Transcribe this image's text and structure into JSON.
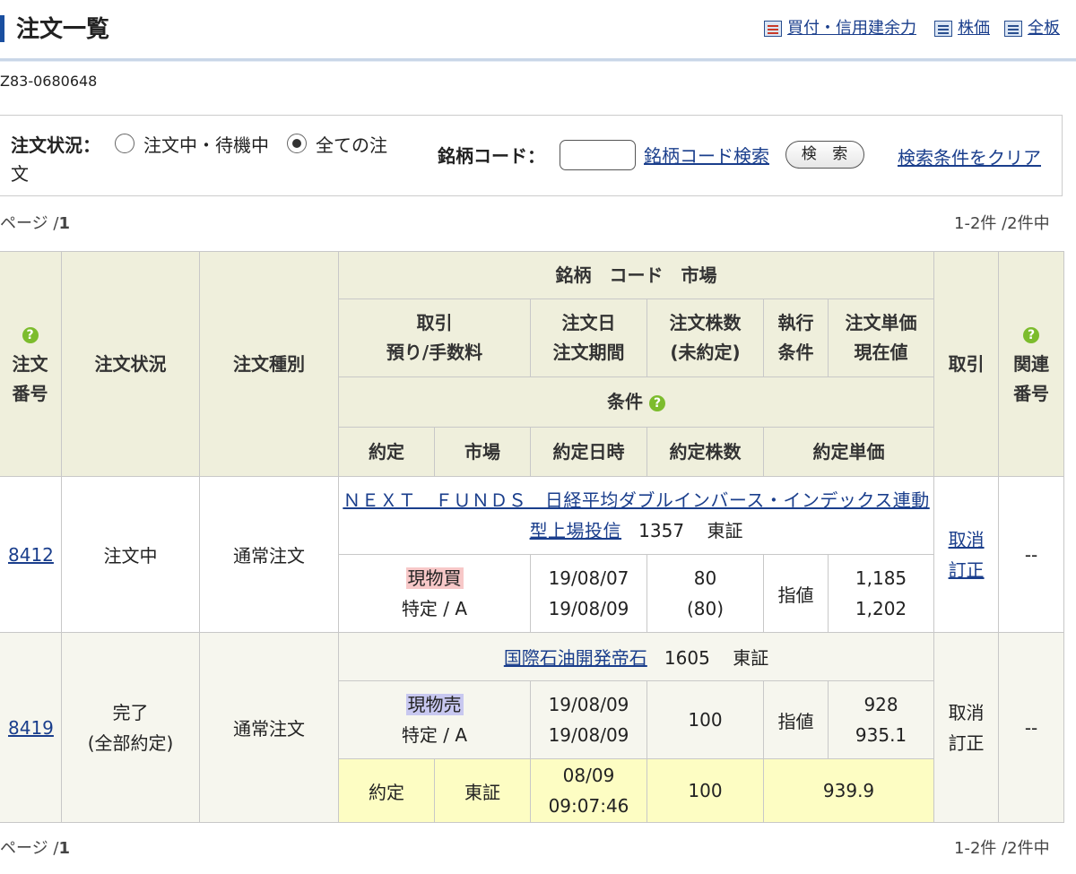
{
  "header": {
    "title": "注文一覧",
    "nav": [
      {
        "label": "買付・信用建余力",
        "icon": "money-calc-icon"
      },
      {
        "label": "株価",
        "icon": "document-list-icon"
      },
      {
        "label": "全板",
        "icon": "board-icon"
      }
    ]
  },
  "account": "Z83-0680648",
  "filter": {
    "status_label": "注文状況：",
    "option_pending": "注文中・待機中",
    "option_all_line1": "全ての注",
    "option_all_line2": "文",
    "selected": "all",
    "code_label": "銘柄コード：",
    "code_value": "",
    "code_search_link": "銘柄コード検索",
    "search_button": "検 索",
    "clear_link": "検索条件をクリア"
  },
  "pager": {
    "page_prefix": "ページ /",
    "page_num": "1",
    "count": "1-2件 /2件中"
  },
  "table": {
    "headers": {
      "order_no_1": "注文",
      "order_no_2": "番号",
      "status": "注文状況",
      "type": "注文種別",
      "stock": "銘柄　コード　市場",
      "trade_1": "取引",
      "trade_2": "預り/手数料",
      "date_1": "注文日",
      "date_2": "注文期間",
      "qty_1": "注文株数",
      "qty_2": "(未約定)",
      "exec_1": "執行",
      "exec_2": "条件",
      "price_1": "注文単価",
      "price_2": "現在値",
      "condition": "条件",
      "fill": "約定",
      "market": "市場",
      "fill_time": "約定日時",
      "fill_qty": "約定株数",
      "fill_price": "約定単価",
      "action": "取引",
      "related_1": "関連",
      "related_2": "番号"
    },
    "rows": [
      {
        "order_no": "8412",
        "status": "注文中",
        "status2": "",
        "type": "通常注文",
        "stock_name": "ＮＥＸＴ　ＦＵＮＤＳ　日経平均ダブルインバース・インデックス連動型上場投信",
        "stock_code": "1357",
        "market": "東証",
        "trade": "現物買",
        "account": "特定 / A",
        "order_date": "19/08/07",
        "period": "19/08/09",
        "qty": "80",
        "unfilled": "(80)",
        "exec": "指値",
        "price": "1,185",
        "current": "1,202",
        "action_cancel": "取消",
        "action_modify": "訂正",
        "related": "--"
      },
      {
        "order_no": "8419",
        "status": "完了",
        "status2": "(全部約定)",
        "type": "通常注文",
        "stock_name": "国際石油開発帝石",
        "stock_code": "1605",
        "market": "東証",
        "trade": "現物売",
        "account": "特定 / A",
        "order_date": "19/08/09",
        "period": "19/08/09",
        "qty": "100",
        "unfilled": "",
        "exec": "指値",
        "price": "928",
        "current": "935.1",
        "action_cancel": "取消",
        "action_modify": "訂正",
        "related": "--",
        "fill": {
          "label": "約定",
          "market": "東証",
          "date": "08/09",
          "time": "09:07:46",
          "qty": "100",
          "price": "939.9"
        }
      }
    ]
  },
  "colors": {
    "accent": "#1a4fa0",
    "header_bg": "#efefdc",
    "fill_bg": "#fdfdc3",
    "buy_tag": "#f7c8c8",
    "sell_tag": "#c8c8f0",
    "help": "#7cbc2d"
  }
}
